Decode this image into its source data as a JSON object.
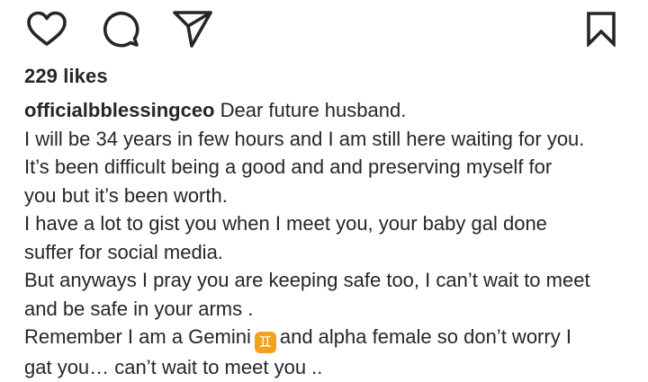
{
  "actions": {
    "like_icon": "heart-outline",
    "comment_icon": "speech-bubble",
    "share_icon": "paper-plane",
    "save_icon": "bookmark-outline"
  },
  "post": {
    "likes": "229 likes",
    "username": "officialbblessingceo",
    "caption_lines": [
      "Dear future husband.",
      "I will be 34 years in few hours and I am still here waiting for you.",
      "It’s been difficult being a good and and preserving myself for",
      "you but it’s been worth.",
      "I have a lot to gist you when I meet you, your baby gal done",
      "suffer for social media.",
      "But anyways I pray you are keeping safe too, I can’t wait to meet",
      "and be safe in your arms .",
      "Remember I am a Gemini",
      "and alpha female so don’t worry I",
      "gat you… can’t wait to meet you .."
    ],
    "emoji_gemini": "♊"
  },
  "colors": {
    "text": "#262626",
    "background": "#ffffff",
    "emoji_bg": "#f2a21e"
  }
}
